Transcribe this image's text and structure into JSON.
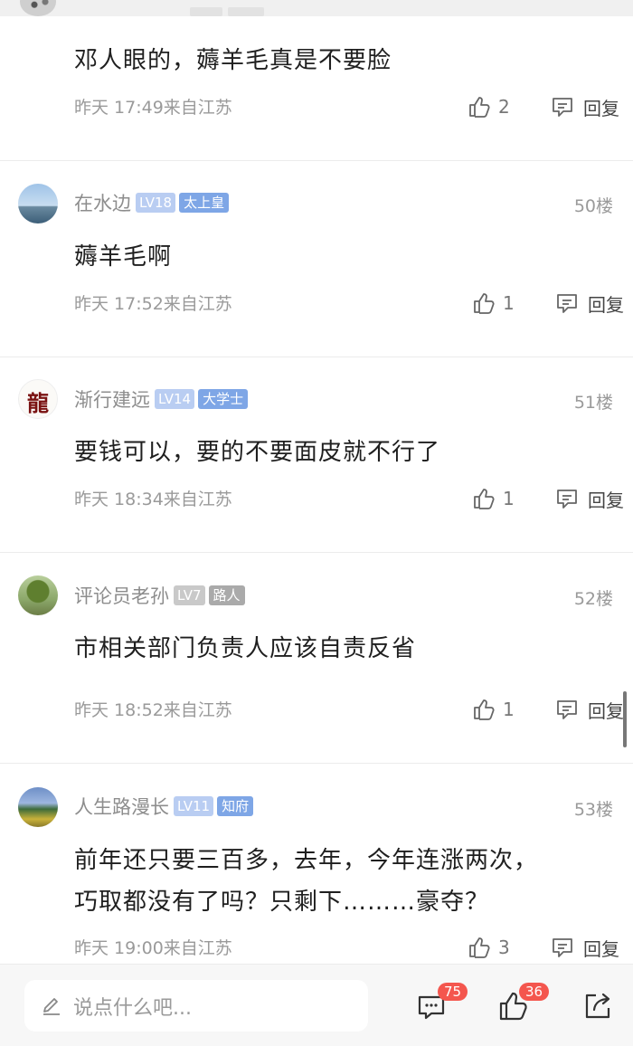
{
  "comments": [
    {
      "text": "邓人眼的，薅羊毛真是不要脸",
      "time": "昨天 17:49来自江苏",
      "likes": "2",
      "reply": "回复"
    },
    {
      "user": "在水边",
      "level": "LV18",
      "title": "太上皇",
      "floor": "50楼",
      "text": "薅羊毛啊",
      "time": "昨天 17:52来自江苏",
      "likes": "1",
      "reply": "回复"
    },
    {
      "user": "渐行建远",
      "level": "LV14",
      "title": "大学士",
      "floor": "51楼",
      "avatar_glyph": "龍",
      "text": "要钱可以，要的不要面皮就不行了",
      "time": "昨天 18:34来自江苏",
      "likes": "1",
      "reply": "回复"
    },
    {
      "user": "评论员老孙",
      "level": "LV7",
      "title": "路人",
      "floor": "52楼",
      "text": "市相关部门负责人应该自责反省",
      "time": "昨天 18:52来自江苏",
      "likes": "1",
      "reply": "回复"
    },
    {
      "user": "人生路漫长",
      "level": "LV11",
      "title": "知府",
      "floor": "53楼",
      "text_line1": "前年还只要三百多，去年，今年连涨两次，",
      "text_line2": "巧取都没有了吗？只剩下………豪夺？",
      "time": "昨天 19:00来自江苏",
      "likes": "3",
      "reply": "回复"
    }
  ],
  "bottom_bar": {
    "input_placeholder": "说点什么吧...",
    "comment_count": "75",
    "like_count": "36",
    "icons": [
      "pen-icon",
      "comment-icon",
      "like-icon",
      "share-icon"
    ]
  },
  "colors": {
    "badge_red": "#f4564e",
    "level_badge": "#b9cdf2",
    "title_badge": "#7ea6e6",
    "meta_gray": "#9a9a9a"
  }
}
